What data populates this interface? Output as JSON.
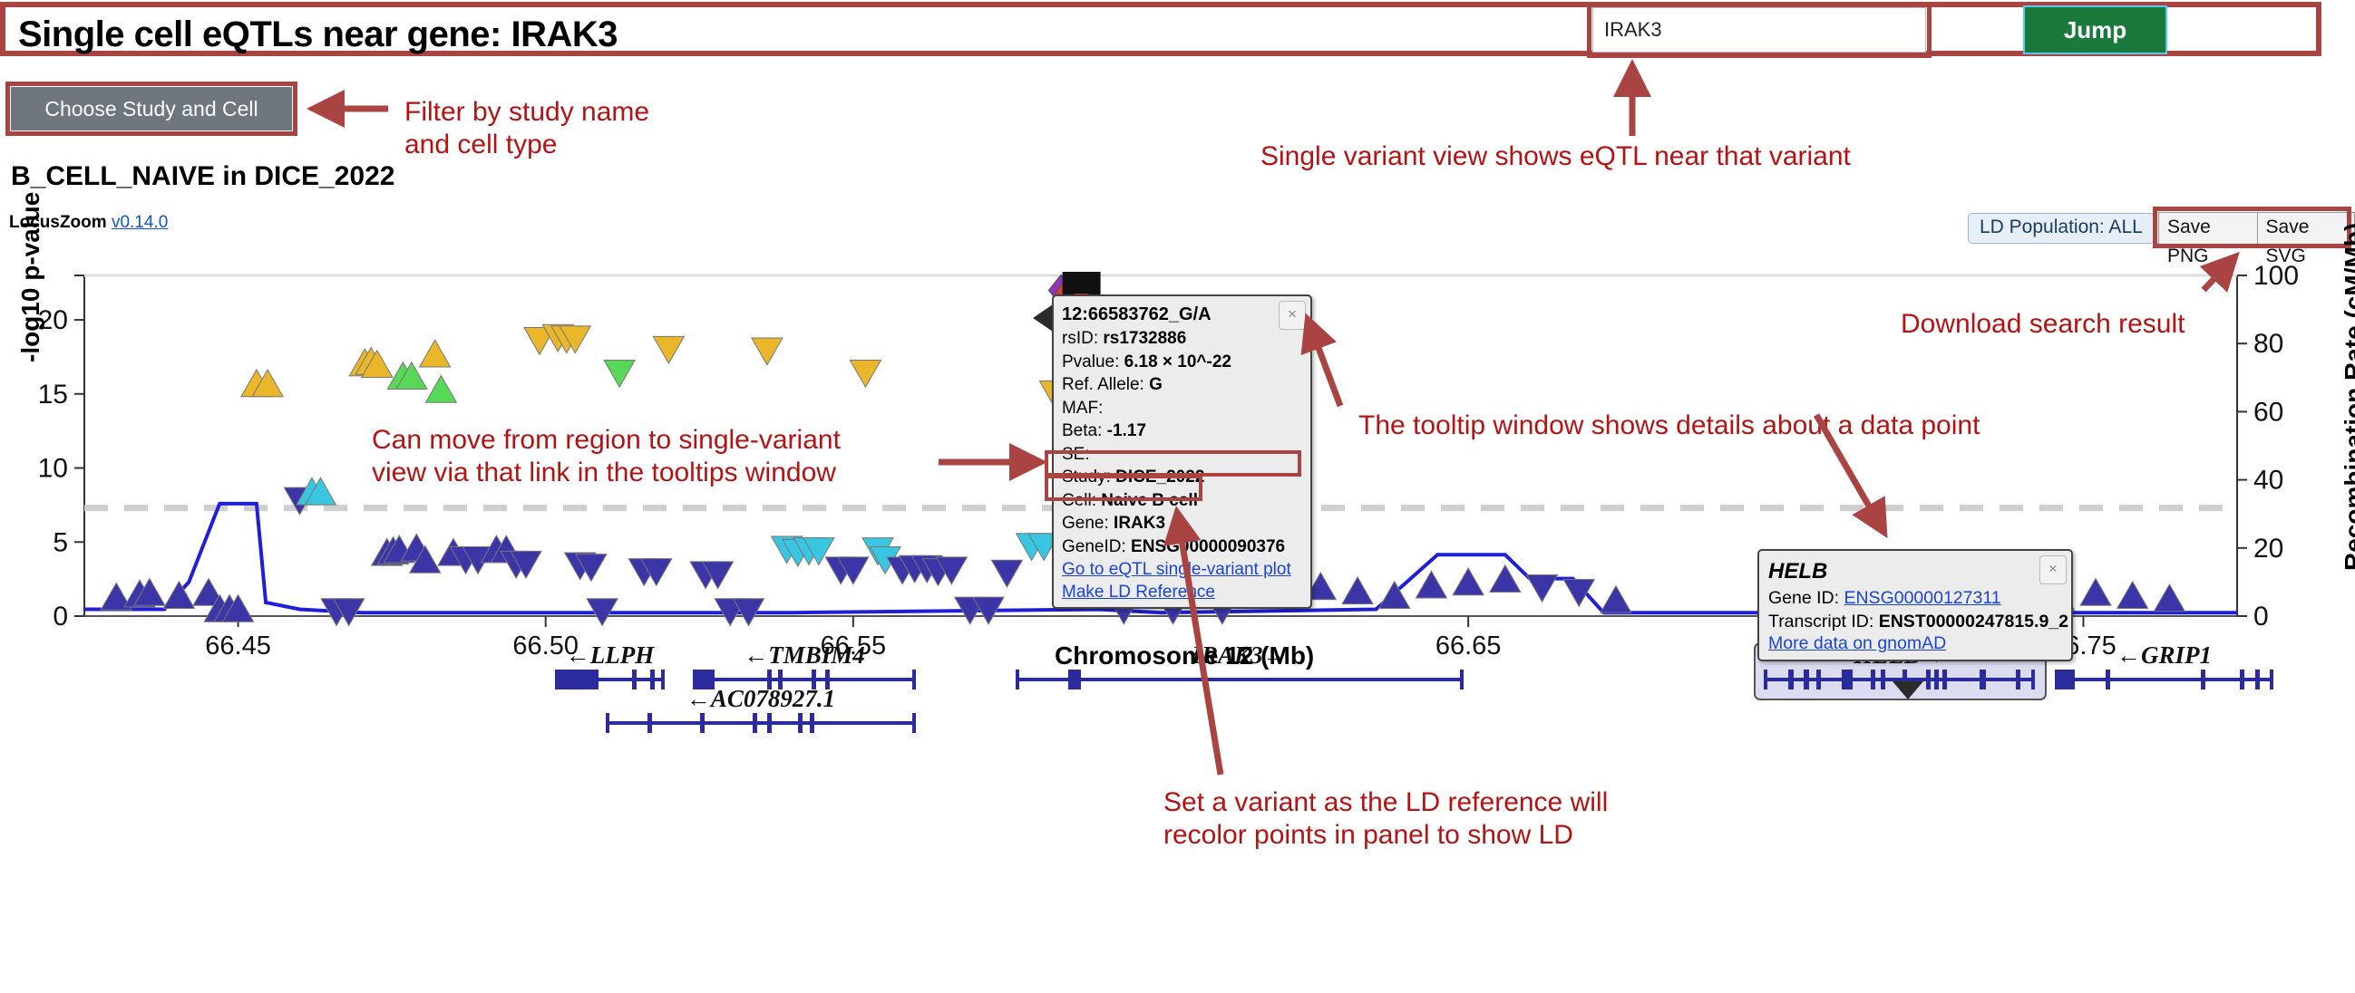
{
  "header": {
    "title": "Single cell eQTLs near gene: IRAK3",
    "search_value": "IRAK3",
    "search_placeholder": "",
    "jump_label": "Jump"
  },
  "controls": {
    "study_button": "Choose Study and Cell",
    "subtitle": "B_CELL_NAIVE in DICE_2022",
    "credit_label": "LocusZoom",
    "credit_version": "v0.14.0",
    "ld_population": "LD Population: ALL",
    "save_png": "Save PNG",
    "save_svg": "Save SVG"
  },
  "variant_tooltip": {
    "title": "12:66583762_G/A",
    "close": "×",
    "rows": [
      {
        "label": "rsID: ",
        "value": "rs1732886"
      },
      {
        "label": "Pvalue: ",
        "value": "6.18 × 10^-22"
      },
      {
        "label": "Ref. Allele: ",
        "value": "G"
      },
      {
        "label": "MAF:",
        "value": ""
      },
      {
        "label": "Beta: ",
        "value": "-1.17"
      },
      {
        "label": "SE:",
        "value": ""
      },
      {
        "label": "Study: ",
        "value": "DICE_2022"
      },
      {
        "label": "Cell: ",
        "value": "Naive B cell"
      },
      {
        "label": "Gene: ",
        "value": "IRAK3"
      },
      {
        "label": "GeneID: ",
        "value": "ENSG00000090376"
      }
    ],
    "link_single_variant": "Go to eQTL single-variant plot",
    "link_ld_reference": "Make LD Reference"
  },
  "gene_tooltip": {
    "title": "HELB",
    "close": "×",
    "gene_id_label": "Gene ID: ",
    "gene_id": "ENSG00000127311",
    "transcript_label": "Transcript ID: ",
    "transcript_id": "ENST00000247815.9_2",
    "gnomad_link": "More data on gnomAD"
  },
  "annotations": [
    {
      "id": "filter",
      "text": "Filter by study name\nand cell type"
    },
    {
      "id": "single-variant",
      "text": "Single variant view shows eQTL near that variant"
    },
    {
      "id": "download",
      "text": "Download search result"
    },
    {
      "id": "tooltip-details",
      "text": "The tooltip window shows details about a data point"
    },
    {
      "id": "region-to-variant",
      "text": "Can move from region to single-variant\nview via that link in the tooltips window"
    },
    {
      "id": "ld-reference",
      "text": "Set a variant as the LD reference will\nrecolor points in panel to show LD"
    }
  ],
  "chart_data": {
    "type": "scatter",
    "title": "B_CELL_NAIVE in DICE_2022",
    "xlabel": "Chromosome 12 (Mb)",
    "ylabel": "-log10 p-value",
    "y2label": "Recombination Rate (cM/Mb)",
    "xlim": [
      66.425,
      66.775
    ],
    "ylim": [
      0,
      23
    ],
    "y2lim": [
      0,
      100
    ],
    "xticks": [
      66.45,
      66.5,
      66.55,
      66.65,
      66.75
    ],
    "xtick_labels": [
      "66.45",
      "66.50",
      "66.55",
      "66.65",
      "66.75"
    ],
    "yticks": [
      0,
      5,
      10,
      15,
      20
    ],
    "ytick_labels": [
      "0",
      "5",
      "10",
      "15",
      "20"
    ],
    "y2ticks": [
      0,
      20,
      40,
      60,
      80,
      100
    ],
    "y2tick_labels": [
      "0",
      "20",
      "40",
      "60",
      "80",
      "100"
    ],
    "grid": false,
    "significance_line": 7.3,
    "ld_colors": {
      "r2_0.8_1.0": "#d43f3a",
      "r2_0.6_0.8": "#eea236",
      "r2_0.4_0.6": "#5cb85c",
      "r2_0.2_0.4": "#46b8da",
      "r2_0.0_0.2": "#357ebd",
      "reference": "#9632b8",
      "recombination_line": "#1f1fd8"
    },
    "points": [
      {
        "x": 66.4302,
        "y": 1.2,
        "c": "#3b35a8",
        "d": "up"
      },
      {
        "x": 66.434,
        "y": 1.4,
        "c": "#3b35a8",
        "d": "up"
      },
      {
        "x": 66.4356,
        "y": 1.5,
        "c": "#3b35a8",
        "d": "up"
      },
      {
        "x": 66.4404,
        "y": 1.3,
        "c": "#3b35a8",
        "d": "up"
      },
      {
        "x": 66.4452,
        "y": 1.5,
        "c": "#3b35a8",
        "d": "up"
      },
      {
        "x": 66.447,
        "y": 0.4,
        "c": "#3b35a8",
        "d": "up"
      },
      {
        "x": 66.4486,
        "y": 0.4,
        "c": "#3b35a8",
        "d": "up"
      },
      {
        "x": 66.45,
        "y": 0.4,
        "c": "#3b35a8",
        "d": "up"
      },
      {
        "x": 66.453,
        "y": 15.6,
        "c": "#eab72a",
        "d": "up"
      },
      {
        "x": 66.4548,
        "y": 15.6,
        "c": "#eab72a",
        "d": "up"
      },
      {
        "x": 66.46,
        "y": 7.9,
        "c": "#3b35a8",
        "d": "down"
      },
      {
        "x": 66.462,
        "y": 8.3,
        "c": "#3ac6e0",
        "d": "up"
      },
      {
        "x": 66.4634,
        "y": 8.3,
        "c": "#3ac6e0",
        "d": "up"
      },
      {
        "x": 66.466,
        "y": 0.4,
        "c": "#3b35a8",
        "d": "down"
      },
      {
        "x": 66.468,
        "y": 0.4,
        "c": "#3b35a8",
        "d": "down"
      },
      {
        "x": 66.4706,
        "y": 17.0,
        "c": "#eab72a",
        "d": "up"
      },
      {
        "x": 66.4716,
        "y": 17.1,
        "c": "#eab72a",
        "d": "up"
      },
      {
        "x": 66.4726,
        "y": 16.9,
        "c": "#eab72a",
        "d": "up"
      },
      {
        "x": 66.4742,
        "y": 4.2,
        "c": "#3b35a8",
        "d": "up"
      },
      {
        "x": 66.4752,
        "y": 4.3,
        "c": "#3b35a8",
        "d": "up"
      },
      {
        "x": 66.4762,
        "y": 4.4,
        "c": "#3b35a8",
        "d": "up"
      },
      {
        "x": 66.4768,
        "y": 16.1,
        "c": "#57d957",
        "d": "up"
      },
      {
        "x": 66.4782,
        "y": 16.1,
        "c": "#57d957",
        "d": "up"
      },
      {
        "x": 66.479,
        "y": 4.5,
        "c": "#3b35a8",
        "d": "up"
      },
      {
        "x": 66.4804,
        "y": 3.7,
        "c": "#3b35a8",
        "d": "up"
      },
      {
        "x": 66.482,
        "y": 17.6,
        "c": "#eab72a",
        "d": "up"
      },
      {
        "x": 66.483,
        "y": 15.2,
        "c": "#57d957",
        "d": "up"
      },
      {
        "x": 66.485,
        "y": 4.2,
        "c": "#3b35a8",
        "d": "up"
      },
      {
        "x": 66.487,
        "y": 3.9,
        "c": "#3b35a8",
        "d": "down"
      },
      {
        "x": 66.489,
        "y": 3.9,
        "c": "#3b35a8",
        "d": "down"
      },
      {
        "x": 66.492,
        "y": 4.4,
        "c": "#3b35a8",
        "d": "up"
      },
      {
        "x": 66.4936,
        "y": 4.4,
        "c": "#3b35a8",
        "d": "up"
      },
      {
        "x": 66.4952,
        "y": 3.6,
        "c": "#3b35a8",
        "d": "down"
      },
      {
        "x": 66.4968,
        "y": 3.6,
        "c": "#3b35a8",
        "d": "down"
      },
      {
        "x": 66.499,
        "y": 18.7,
        "c": "#eab72a",
        "d": "down"
      },
      {
        "x": 66.502,
        "y": 18.9,
        "c": "#eab72a",
        "d": "down"
      },
      {
        "x": 66.5034,
        "y": 18.8,
        "c": "#eab72a",
        "d": "down"
      },
      {
        "x": 66.5048,
        "y": 18.8,
        "c": "#eab72a",
        "d": "down"
      },
      {
        "x": 66.5056,
        "y": 3.5,
        "c": "#3b35a8",
        "d": "down"
      },
      {
        "x": 66.5074,
        "y": 3.4,
        "c": "#3b35a8",
        "d": "down"
      },
      {
        "x": 66.5092,
        "y": 0.4,
        "c": "#3b35a8",
        "d": "down"
      },
      {
        "x": 66.512,
        "y": 16.5,
        "c": "#57d957",
        "d": "down"
      },
      {
        "x": 66.516,
        "y": 3.1,
        "c": "#3b35a8",
        "d": "down"
      },
      {
        "x": 66.518,
        "y": 3.1,
        "c": "#3b35a8",
        "d": "down"
      },
      {
        "x": 66.52,
        "y": 18.1,
        "c": "#eab72a",
        "d": "down"
      },
      {
        "x": 66.526,
        "y": 2.9,
        "c": "#3b35a8",
        "d": "down"
      },
      {
        "x": 66.528,
        "y": 2.9,
        "c": "#3b35a8",
        "d": "down"
      },
      {
        "x": 66.53,
        "y": 0.4,
        "c": "#3b35a8",
        "d": "down"
      },
      {
        "x": 66.533,
        "y": 0.4,
        "c": "#3b35a8",
        "d": "down"
      },
      {
        "x": 66.536,
        "y": 18.0,
        "c": "#eab72a",
        "d": "down"
      },
      {
        "x": 66.5392,
        "y": 4.6,
        "c": "#3ac6e0",
        "d": "down"
      },
      {
        "x": 66.541,
        "y": 4.4,
        "c": "#3ac6e0",
        "d": "down"
      },
      {
        "x": 66.5428,
        "y": 4.5,
        "c": "#3ac6e0",
        "d": "down"
      },
      {
        "x": 66.5444,
        "y": 4.5,
        "c": "#3ac6e0",
        "d": "down"
      },
      {
        "x": 66.548,
        "y": 3.2,
        "c": "#3b35a8",
        "d": "down"
      },
      {
        "x": 66.55,
        "y": 3.2,
        "c": "#3b35a8",
        "d": "down"
      },
      {
        "x": 66.552,
        "y": 16.5,
        "c": "#eab72a",
        "d": "down"
      },
      {
        "x": 66.554,
        "y": 4.5,
        "c": "#3ac6e0",
        "d": "down"
      },
      {
        "x": 66.5552,
        "y": 3.9,
        "c": "#3ac6e0",
        "d": "down"
      },
      {
        "x": 66.558,
        "y": 3.2,
        "c": "#3b35a8",
        "d": "down"
      },
      {
        "x": 66.56,
        "y": 3.3,
        "c": "#3b35a8",
        "d": "down"
      },
      {
        "x": 66.562,
        "y": 3.3,
        "c": "#3b35a8",
        "d": "down"
      },
      {
        "x": 66.5638,
        "y": 3.1,
        "c": "#3b35a8",
        "d": "down"
      },
      {
        "x": 66.566,
        "y": 3.2,
        "c": "#3b35a8",
        "d": "down"
      },
      {
        "x": 66.569,
        "y": 0.5,
        "c": "#3b35a8",
        "d": "down"
      },
      {
        "x": 66.572,
        "y": 0.5,
        "c": "#3b35a8",
        "d": "down"
      },
      {
        "x": 66.575,
        "y": 3.0,
        "c": "#3b35a8",
        "d": "down"
      },
      {
        "x": 66.579,
        "y": 4.8,
        "c": "#3ac6e0",
        "d": "down"
      },
      {
        "x": 66.581,
        "y": 4.8,
        "c": "#3ac6e0",
        "d": "down"
      },
      {
        "x": 66.5828,
        "y": 15.1,
        "c": "#eab72a",
        "d": "down"
      },
      {
        "x": 66.5838,
        "y": 22.0,
        "c": "#9632b8",
        "d": "diamond"
      },
      {
        "x": 66.5848,
        "y": 21.8,
        "c": "#d43f3a",
        "d": "diamond"
      },
      {
        "x": 66.5856,
        "y": 19.6,
        "c": "#d43f3a",
        "d": "down"
      },
      {
        "x": 66.588,
        "y": 15.0,
        "c": "#57d957",
        "d": "down"
      },
      {
        "x": 66.591,
        "y": 3.0,
        "c": "#3b35a8",
        "d": "down"
      },
      {
        "x": 66.594,
        "y": 0.5,
        "c": "#3b35a8",
        "d": "down"
      },
      {
        "x": 66.598,
        "y": 2.9,
        "c": "#3b35a8",
        "d": "down"
      },
      {
        "x": 66.602,
        "y": 0.5,
        "c": "#3b35a8",
        "d": "down"
      },
      {
        "x": 66.606,
        "y": 2.8,
        "c": "#3b35a8",
        "d": "down"
      },
      {
        "x": 66.61,
        "y": 0.5,
        "c": "#3b35a8",
        "d": "down"
      },
      {
        "x": 66.614,
        "y": 2.6,
        "c": "#3b35a8",
        "d": "down"
      },
      {
        "x": 66.62,
        "y": 4.8,
        "c": "#3ac6e0",
        "d": "up"
      },
      {
        "x": 66.626,
        "y": 1.9,
        "c": "#3b35a8",
        "d": "up"
      },
      {
        "x": 66.632,
        "y": 1.6,
        "c": "#3b35a8",
        "d": "up"
      },
      {
        "x": 66.638,
        "y": 1.3,
        "c": "#3b35a8",
        "d": "up"
      },
      {
        "x": 66.644,
        "y": 2.0,
        "c": "#3b35a8",
        "d": "up"
      },
      {
        "x": 66.65,
        "y": 2.2,
        "c": "#3b35a8",
        "d": "up"
      },
      {
        "x": 66.656,
        "y": 2.4,
        "c": "#3b35a8",
        "d": "up"
      },
      {
        "x": 66.662,
        "y": 2.0,
        "c": "#3b35a8",
        "d": "down"
      },
      {
        "x": 66.668,
        "y": 1.7,
        "c": "#3b35a8",
        "d": "down"
      },
      {
        "x": 66.674,
        "y": 1.0,
        "c": "#3b35a8",
        "d": "up"
      },
      {
        "x": 66.71,
        "y": 1.6,
        "c": "#3b35a8",
        "d": "up"
      },
      {
        "x": 66.716,
        "y": 1.9,
        "c": "#3b35a8",
        "d": "up"
      },
      {
        "x": 66.722,
        "y": 1.5,
        "c": "#3b35a8",
        "d": "up"
      },
      {
        "x": 66.728,
        "y": 1.3,
        "c": "#3b35a8",
        "d": "up"
      },
      {
        "x": 66.734,
        "y": 1.6,
        "c": "#3b35a8",
        "d": "up"
      },
      {
        "x": 66.74,
        "y": 1.4,
        "c": "#3b35a8",
        "d": "up"
      },
      {
        "x": 66.746,
        "y": 1.2,
        "c": "#3b35a8",
        "d": "up"
      },
      {
        "x": 66.752,
        "y": 1.5,
        "c": "#3b35a8",
        "d": "up"
      },
      {
        "x": 66.758,
        "y": 1.3,
        "c": "#3b35a8",
        "d": "up"
      },
      {
        "x": 66.764,
        "y": 1.1,
        "c": "#3b35a8",
        "d": "up"
      }
    ],
    "recombination": [
      {
        "x": 66.425,
        "y": 2
      },
      {
        "x": 66.438,
        "y": 2
      },
      {
        "x": 66.442,
        "y": 10
      },
      {
        "x": 66.447,
        "y": 33
      },
      {
        "x": 66.453,
        "y": 33
      },
      {
        "x": 66.4545,
        "y": 4
      },
      {
        "x": 66.46,
        "y": 2
      },
      {
        "x": 66.47,
        "y": 1
      },
      {
        "x": 66.54,
        "y": 1
      },
      {
        "x": 66.59,
        "y": 2
      },
      {
        "x": 66.6,
        "y": 1
      },
      {
        "x": 66.635,
        "y": 2
      },
      {
        "x": 66.645,
        "y": 18
      },
      {
        "x": 66.656,
        "y": 18
      },
      {
        "x": 66.66,
        "y": 11
      },
      {
        "x": 66.667,
        "y": 11
      },
      {
        "x": 66.672,
        "y": 1
      },
      {
        "x": 66.775,
        "y": 1
      }
    ]
  },
  "genes": [
    {
      "name": "LLPH",
      "arrow": "left",
      "label": "←LLPH",
      "row": 0,
      "x1": 614,
      "x2": 731,
      "exons": [
        [
          614,
          660
        ],
        [
          697,
          702
        ],
        [
          717,
          722
        ]
      ]
    },
    {
      "name": "TMBIM4",
      "arrow": "left",
      "label": "←TMBIM4",
      "row": 0,
      "x1": 766,
      "x2": 1008,
      "exons": [
        [
          766,
          788
        ],
        [
          846,
          851
        ],
        [
          858,
          863
        ],
        [
          895,
          900
        ],
        [
          910,
          915
        ]
      ]
    },
    {
      "name": "AC078927.1",
      "arrow": "left",
      "label": "←AC078927.1",
      "row": 1,
      "x1": 670,
      "x2": 1008,
      "exons": [
        [
          714,
          719
        ],
        [
          772,
          777
        ],
        [
          830,
          835
        ],
        [
          846,
          851
        ],
        [
          880,
          885
        ],
        [
          893,
          898
        ]
      ]
    },
    {
      "name": "IRAK3",
      "arrow": "right",
      "label": "IRAK3→",
      "row": 0,
      "x1": 1122,
      "x2": 1612,
      "exons": [
        [
          1178,
          1192
        ]
      ]
    },
    {
      "name": "HELB",
      "arrow": "right",
      "label": "HELB→",
      "row": 0,
      "x1": 1947,
      "x2": 2242,
      "exons": [
        [
          1972,
          1978
        ],
        [
          1989,
          1995
        ],
        [
          2003,
          2008
        ],
        [
          2031,
          2043
        ],
        [
          2063,
          2068
        ],
        [
          2074,
          2079
        ],
        [
          2098,
          2103
        ],
        [
          2124,
          2129
        ],
        [
          2133,
          2138
        ],
        [
          2142,
          2147
        ],
        [
          2183,
          2190
        ],
        [
          2223,
          2228
        ]
      ],
      "highlighted": true
    },
    {
      "name": "GRIP1",
      "arrow": "left",
      "label": "←GRIP1",
      "row": 0,
      "x1": 2268,
      "x2": 2505,
      "exons": [
        [
          2268,
          2288
        ],
        [
          2322,
          2327
        ],
        [
          2427,
          2432
        ],
        [
          2470,
          2475
        ],
        [
          2487,
          2492
        ]
      ]
    }
  ]
}
